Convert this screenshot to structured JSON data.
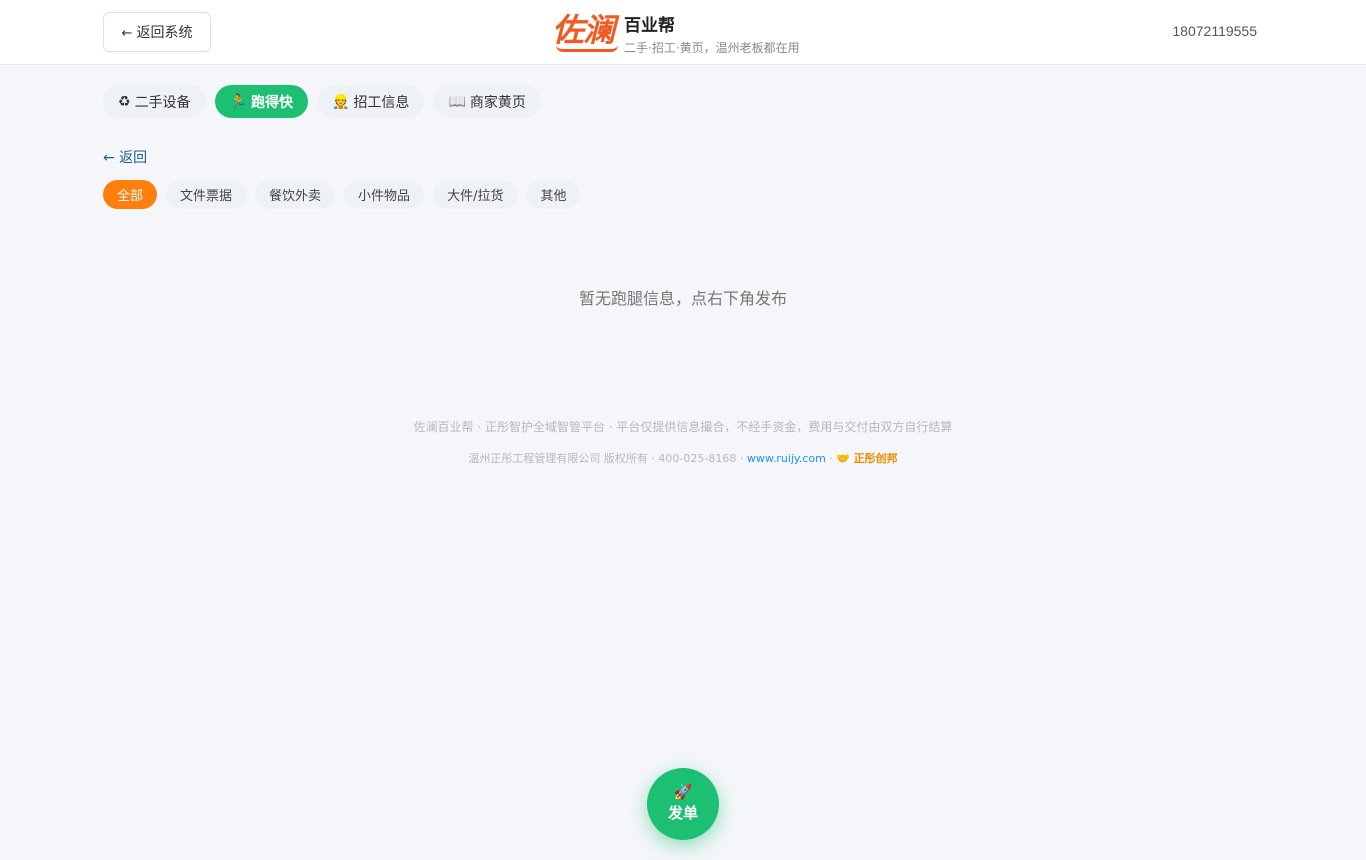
{
  "header": {
    "back_label": "返回系统",
    "back_arrow": "←",
    "logo_text": "佐澜",
    "brand_name": "百业帮",
    "brand_sub": "二手·招工·黄页，温州老板都在用",
    "phone": "18072119555"
  },
  "nav": {
    "tabs": [
      {
        "icon": "♻",
        "icon_name": "recycle-icon",
        "label": "二手设备"
      },
      {
        "icon": "🏃",
        "icon_name": "runner-icon",
        "label": "跑得快"
      },
      {
        "icon": "👷",
        "icon_name": "worker-icon",
        "label": "招工信息"
      },
      {
        "icon": "📖",
        "icon_name": "book-icon",
        "label": "商家黄页"
      }
    ],
    "active_index": 1
  },
  "back_link": "← 返回",
  "filters": {
    "chips": [
      "全部",
      "文件票据",
      "餐饮外卖",
      "小件物品",
      "大件/拉货",
      "其他"
    ],
    "active_index": 0
  },
  "empty_message": "暂无跑腿信息，点右下角发布",
  "footer": {
    "line1": "佐澜百业帮 · 正彤智护全域智管平台 · 平台仅提供信息撮合，不经手资金，费用与交付由双方自行结算",
    "company": "温州正彤工程管理有限公司 版权所有 · 400-025-8168 ·",
    "website": "www.ruijy.com",
    "separator": "·",
    "partner_icon": "🤝",
    "partner": "正彤创邦"
  },
  "fab": {
    "icon": "🚀",
    "label": "发单"
  },
  "colors": {
    "brand_orange": "#f15a22",
    "active_green": "#1dbf73",
    "chip_active_orange": "#ff7f0e",
    "link_blue": "#1e90ff"
  }
}
